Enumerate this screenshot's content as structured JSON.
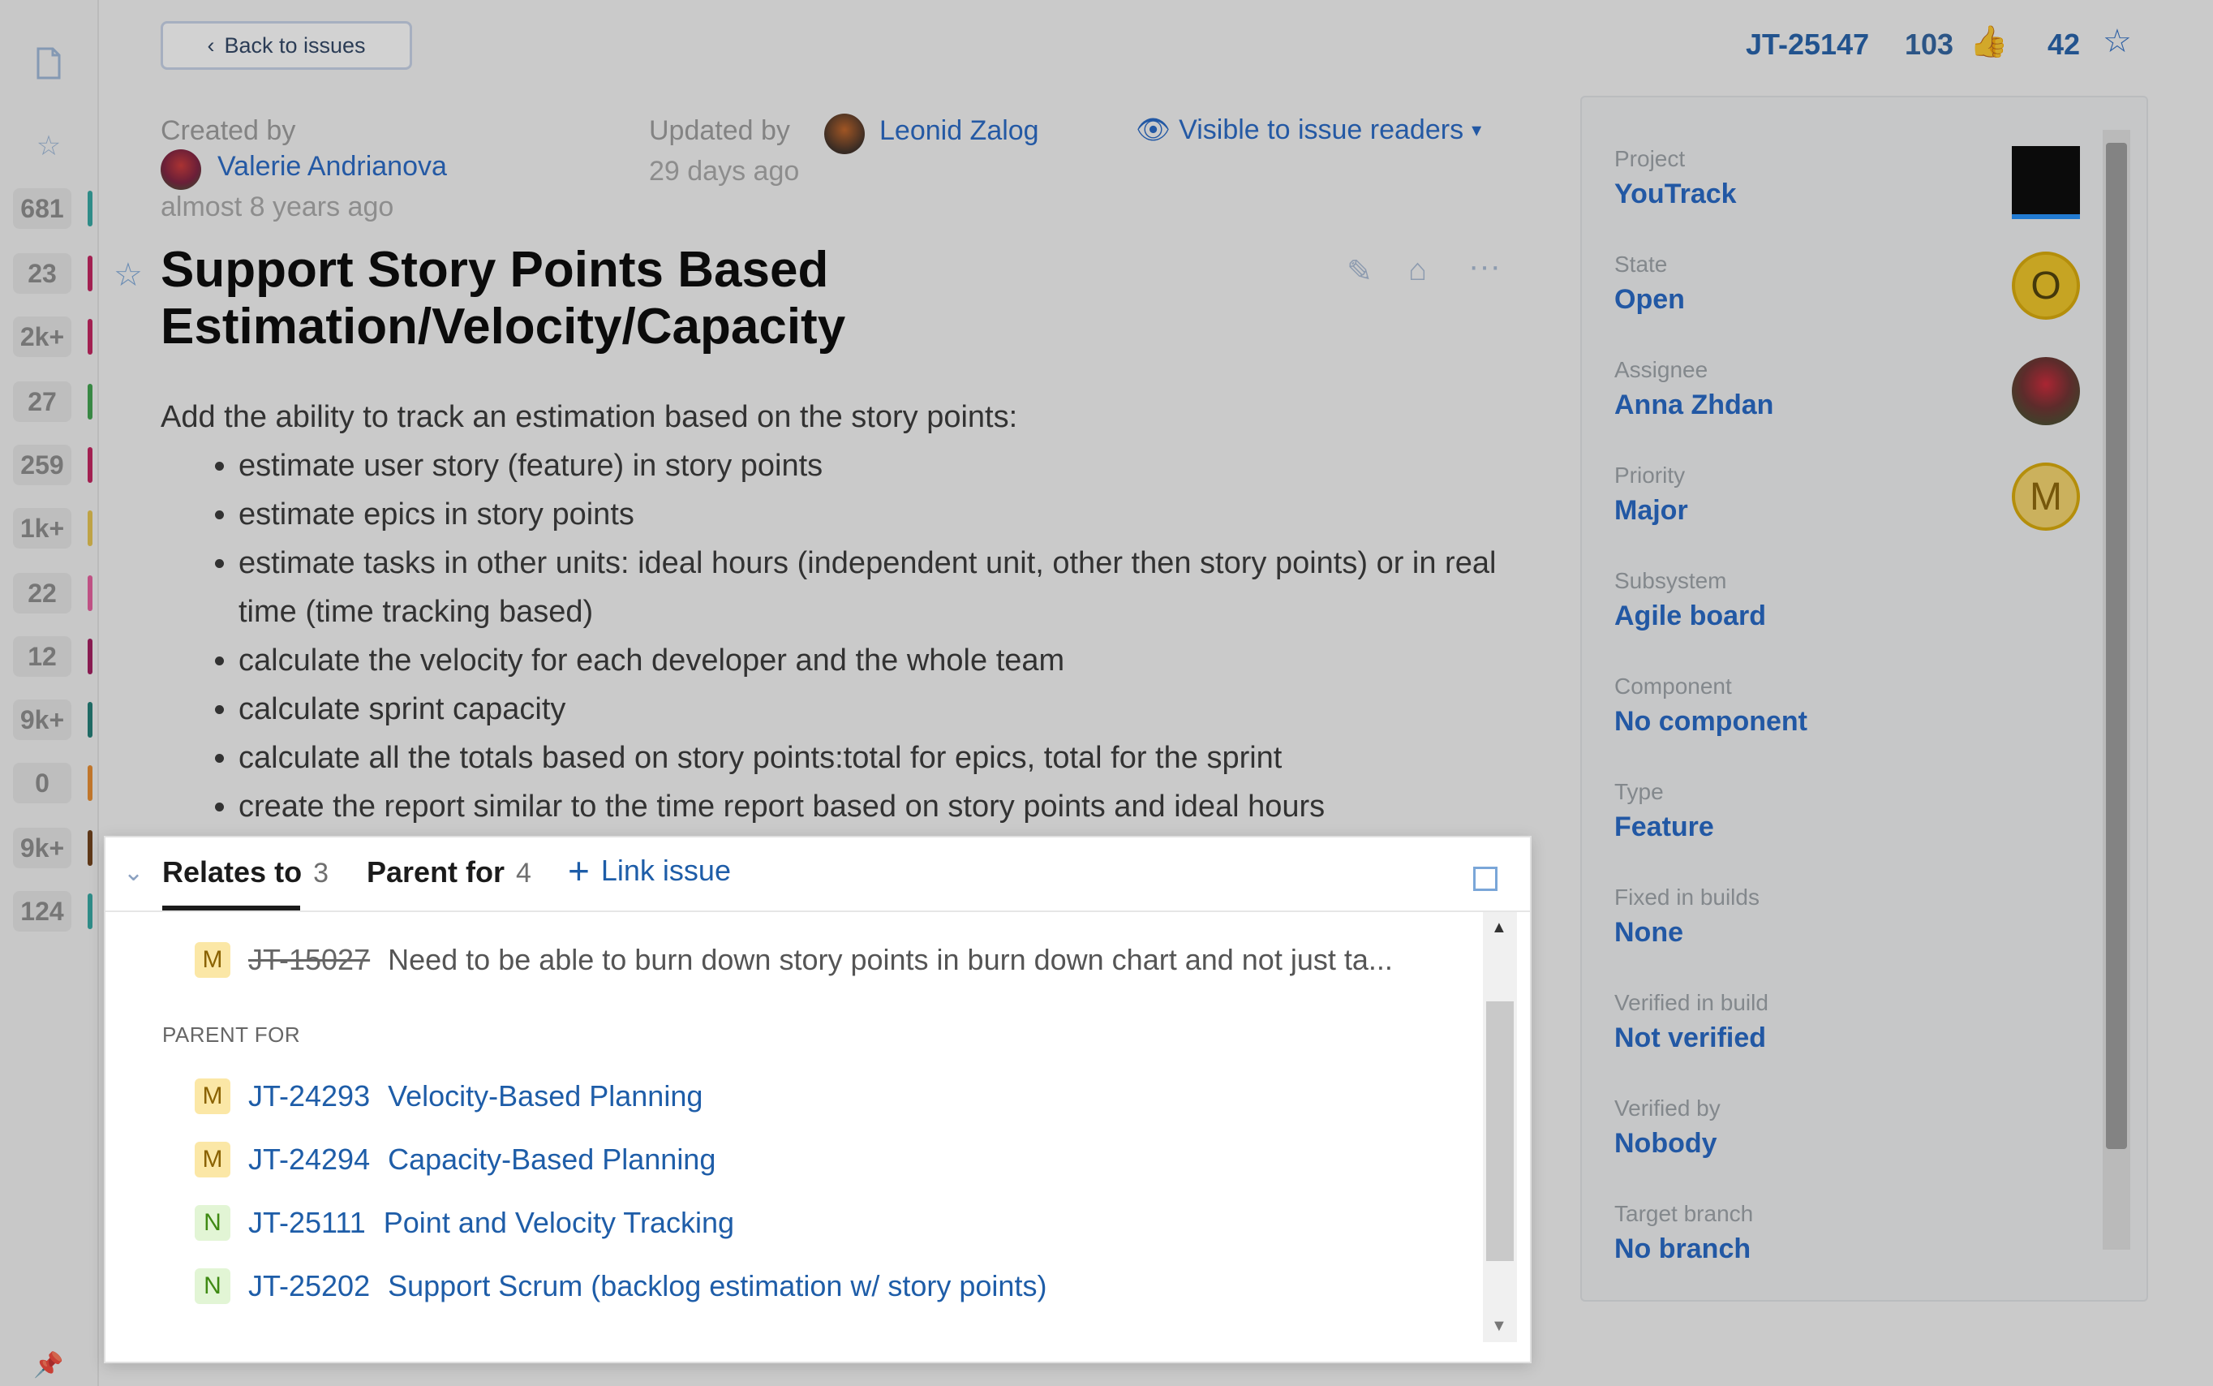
{
  "rail": {
    "counts": [
      "681",
      "23",
      "2k+",
      "27",
      "259",
      "1k+",
      "22",
      "12",
      "9k+",
      "0",
      "9k+",
      "124"
    ],
    "bar_colors": [
      "#2fa6a0",
      "#c21b5a",
      "#c21b5a",
      "#3aa04a",
      "#c21b5a",
      "#e7c34b",
      "#e75a9b",
      "#a0155a",
      "#1a7a73",
      "#e88a2a",
      "#6b3a12",
      "#2fa6a0"
    ]
  },
  "header": {
    "back_label": "Back to issues",
    "issue_id": "JT-25147",
    "votes": "103",
    "stars": "42"
  },
  "meta": {
    "created_label": "Created by",
    "created_user": "Valerie Andrianova",
    "created_when": "almost 8 years ago",
    "updated_label": "Updated by",
    "updated_user": "Leonid Zalog",
    "updated_when": "29 days ago",
    "visibility": "Visible to issue readers"
  },
  "issue": {
    "title": "Support Story Points Based Estimation/Velocity/Capacity",
    "intro": "Add the ability to track an estimation based on the story points:",
    "bullets": [
      "estimate user story (feature) in story points",
      "estimate epics in story points",
      "estimate tasks in other units: ideal hours (independent unit, other then story points) or in real time (time tracking based)",
      "calculate the velocity for each developer and the whole team",
      "calculate sprint capacity",
      "calculate all the totals based on story points:total for epics, total for the sprint",
      "create the report similar to the time report based on story points and ideal hours"
    ]
  },
  "fields": [
    {
      "label": "Project",
      "value": "YouTrack"
    },
    {
      "label": "State",
      "value": "Open"
    },
    {
      "label": "Assignee",
      "value": "Anna Zhdan"
    },
    {
      "label": "Priority",
      "value": "Major"
    },
    {
      "label": "Subsystem",
      "value": "Agile board"
    },
    {
      "label": "Component",
      "value": "No component"
    },
    {
      "label": "Type",
      "value": "Feature"
    },
    {
      "label": "Fixed in builds",
      "value": "None"
    },
    {
      "label": "Verified in build",
      "value": "Not verified"
    },
    {
      "label": "Verified by",
      "value": "Nobody"
    },
    {
      "label": "Target branch",
      "value": "No branch"
    }
  ],
  "side_badges": {
    "state": "O",
    "priority": "M"
  },
  "links": {
    "tabs": [
      {
        "label": "Relates to",
        "count": "3"
      },
      {
        "label": "Parent for",
        "count": "4"
      }
    ],
    "add_label": "Link issue",
    "relates": [
      {
        "badge": "M",
        "id": "JT-15027",
        "title": "Need to be able to burn down story points in burn down chart and not just ta..."
      }
    ],
    "parent_section_label": "PARENT FOR",
    "parent": [
      {
        "badge": "M",
        "id": "JT-24293",
        "title": "Velocity-Based Planning"
      },
      {
        "badge": "M",
        "id": "JT-24294",
        "title": "Capacity-Based Planning"
      },
      {
        "badge": "N",
        "id": "JT-25111",
        "title": "Point and Velocity Tracking"
      },
      {
        "badge": "N",
        "id": "JT-25202",
        "title": "Support Scrum (backlog estimation w/ story points)"
      }
    ]
  }
}
